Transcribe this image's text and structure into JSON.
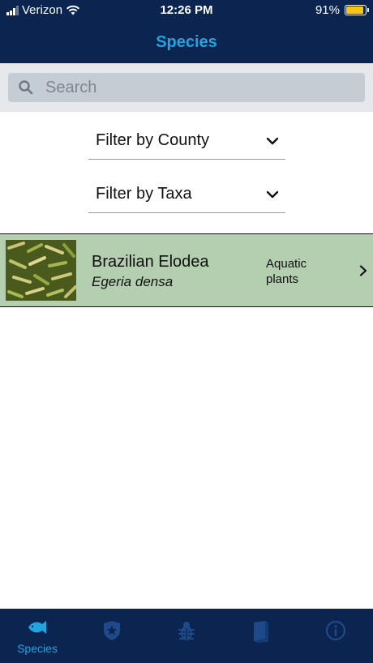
{
  "status_bar": {
    "carrier": "Verizon",
    "time": "12:26 PM",
    "battery": "91%"
  },
  "nav": {
    "title": "Species"
  },
  "search": {
    "placeholder": "Search"
  },
  "filters": {
    "county_label": "Filter by County",
    "taxa_label": "Filter by Taxa"
  },
  "species": [
    {
      "common_name": "Brazilian Elodea",
      "scientific_name": "Egeria densa",
      "taxa": "Aquatic plants"
    }
  ],
  "tab_bar": {
    "active": "Species",
    "tabs": [
      {
        "label": "Species",
        "icon": "fish-icon"
      },
      {
        "label": "",
        "icon": "shield-star-icon"
      },
      {
        "label": "",
        "icon": "bug-icon"
      },
      {
        "label": "",
        "icon": "book-icon"
      },
      {
        "label": "",
        "icon": "info-icon"
      }
    ]
  },
  "colors": {
    "navy": "#0b2450",
    "accent_blue": "#23a3e0",
    "inactive_icon": "#1e4a8a",
    "row_green": "#b4cfb0"
  }
}
